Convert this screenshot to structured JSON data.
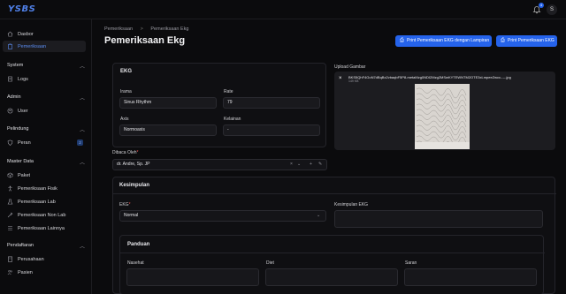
{
  "app": {
    "logo": "YSBS",
    "notification_count": "4",
    "avatar_initial": "S"
  },
  "sidebar": {
    "top_items": [
      {
        "label": "Dasbor",
        "icon": "home-icon"
      },
      {
        "label": "Pemeriksaan",
        "icon": "clipboard-icon",
        "active": true
      }
    ],
    "groups": [
      {
        "label": "System",
        "items": [
          {
            "label": "Logs",
            "icon": "log-icon"
          }
        ]
      },
      {
        "label": "Admin",
        "items": [
          {
            "label": "User",
            "icon": "user-icon"
          }
        ]
      },
      {
        "label": "Pelindung",
        "items": [
          {
            "label": "Peran",
            "icon": "shield-icon",
            "badge": "2"
          }
        ]
      },
      {
        "label": "Master Data",
        "items": [
          {
            "label": "Paket",
            "icon": "package-icon"
          },
          {
            "label": "Pemeriksaan Fisik",
            "icon": "person-icon"
          },
          {
            "label": "Pemeriksaan Lab",
            "icon": "flask-icon"
          },
          {
            "label": "Pemeriksaan Non Lab",
            "icon": "syringe-icon"
          },
          {
            "label": "Pemeriksaan Lainnya",
            "icon": "list-icon"
          }
        ]
      },
      {
        "label": "Pendaftaran",
        "items": [
          {
            "label": "Perusahaan",
            "icon": "building-icon"
          },
          {
            "label": "Pasien",
            "icon": "users-icon"
          }
        ]
      }
    ]
  },
  "breadcrumb": {
    "parent": "Pemeriksaan",
    "separator": ">",
    "current": "Pemeriksaan Ekg"
  },
  "page": {
    "title": "Pemeriksaan Ekg",
    "print_with_attachment": "Print Pemeriksaan EKG dengan Lampiran",
    "print": "Print Pemeriksaan EKG"
  },
  "ekg": {
    "title": "EKG",
    "irama_label": "Irama",
    "irama_value": "Sinus Rhythm",
    "rate_label": "Rate",
    "rate_value": "79",
    "axis_label": "Axis",
    "axis_value": "Normoaxis",
    "kelainan_label": "Kelainan",
    "kelainan_value": "-"
  },
  "upload": {
    "label": "Upload Gambar",
    "file_name": "BKS5QhF4GoN7dBqBx2vbaqbF5P8-metaMzg0NDI2Mzg2MSwKYTEWNTM2OTE3xLmpeeZwcc----.jpg",
    "file_size": "149 KB"
  },
  "dibaca_oleh": {
    "label": "Dibaca Oleh",
    "value": "dr. Andre, Sp. JP"
  },
  "kesimpulan": {
    "title": "Kesimpulan",
    "ekg_label": "EKG",
    "ekg_value": "Normal",
    "kesimpulan_ekg_label": "Kesimpulan EKG"
  },
  "panduan": {
    "title": "Panduan",
    "nasehat_label": "Nasehat",
    "diet_label": "Diet",
    "saran_label": "Saran"
  },
  "colors": {
    "accent": "#2563eb",
    "background": "#0b0b0d",
    "card": "#0f0f12"
  }
}
